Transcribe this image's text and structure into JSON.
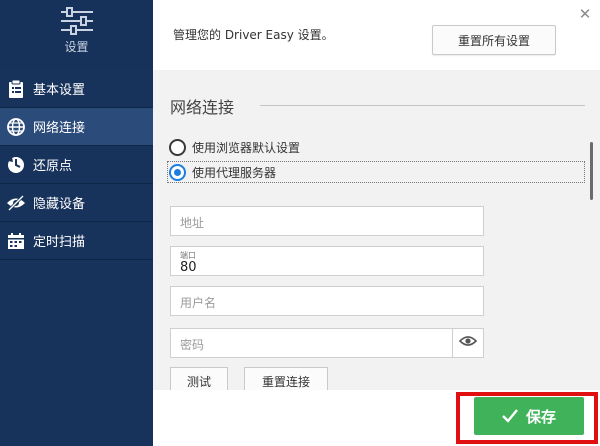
{
  "sidebar": {
    "header_title": "设置",
    "items": [
      {
        "label": "基本设置",
        "icon": "clipboard-icon"
      },
      {
        "label": "网络连接",
        "icon": "globe-icon",
        "active": true
      },
      {
        "label": "还原点",
        "icon": "restore-icon"
      },
      {
        "label": "隐藏设备",
        "icon": "eye-slash-icon"
      },
      {
        "label": "定时扫描",
        "icon": "calendar-icon"
      }
    ]
  },
  "header": {
    "description": "管理您的 Driver Easy 设置。",
    "reset_all_label": "重置所有设置"
  },
  "network": {
    "section_title": "网络连接",
    "option_browser": "使用浏览器默认设置",
    "option_proxy": "使用代理服务器",
    "selected": "proxy",
    "address_placeholder": "地址",
    "port_label": "端口",
    "port_value": "80",
    "username_placeholder": "用户名",
    "password_placeholder": "密码",
    "test_label": "测试",
    "reset_connection_label": "重置连接"
  },
  "footer": {
    "save_label": "保存"
  },
  "colors": {
    "sidebar_bg": "#18335b",
    "sidebar_active": "#2b4c7a",
    "accent_blue": "#1e7ee0",
    "save_green": "#3fb25a",
    "highlight_red": "#e01010"
  }
}
